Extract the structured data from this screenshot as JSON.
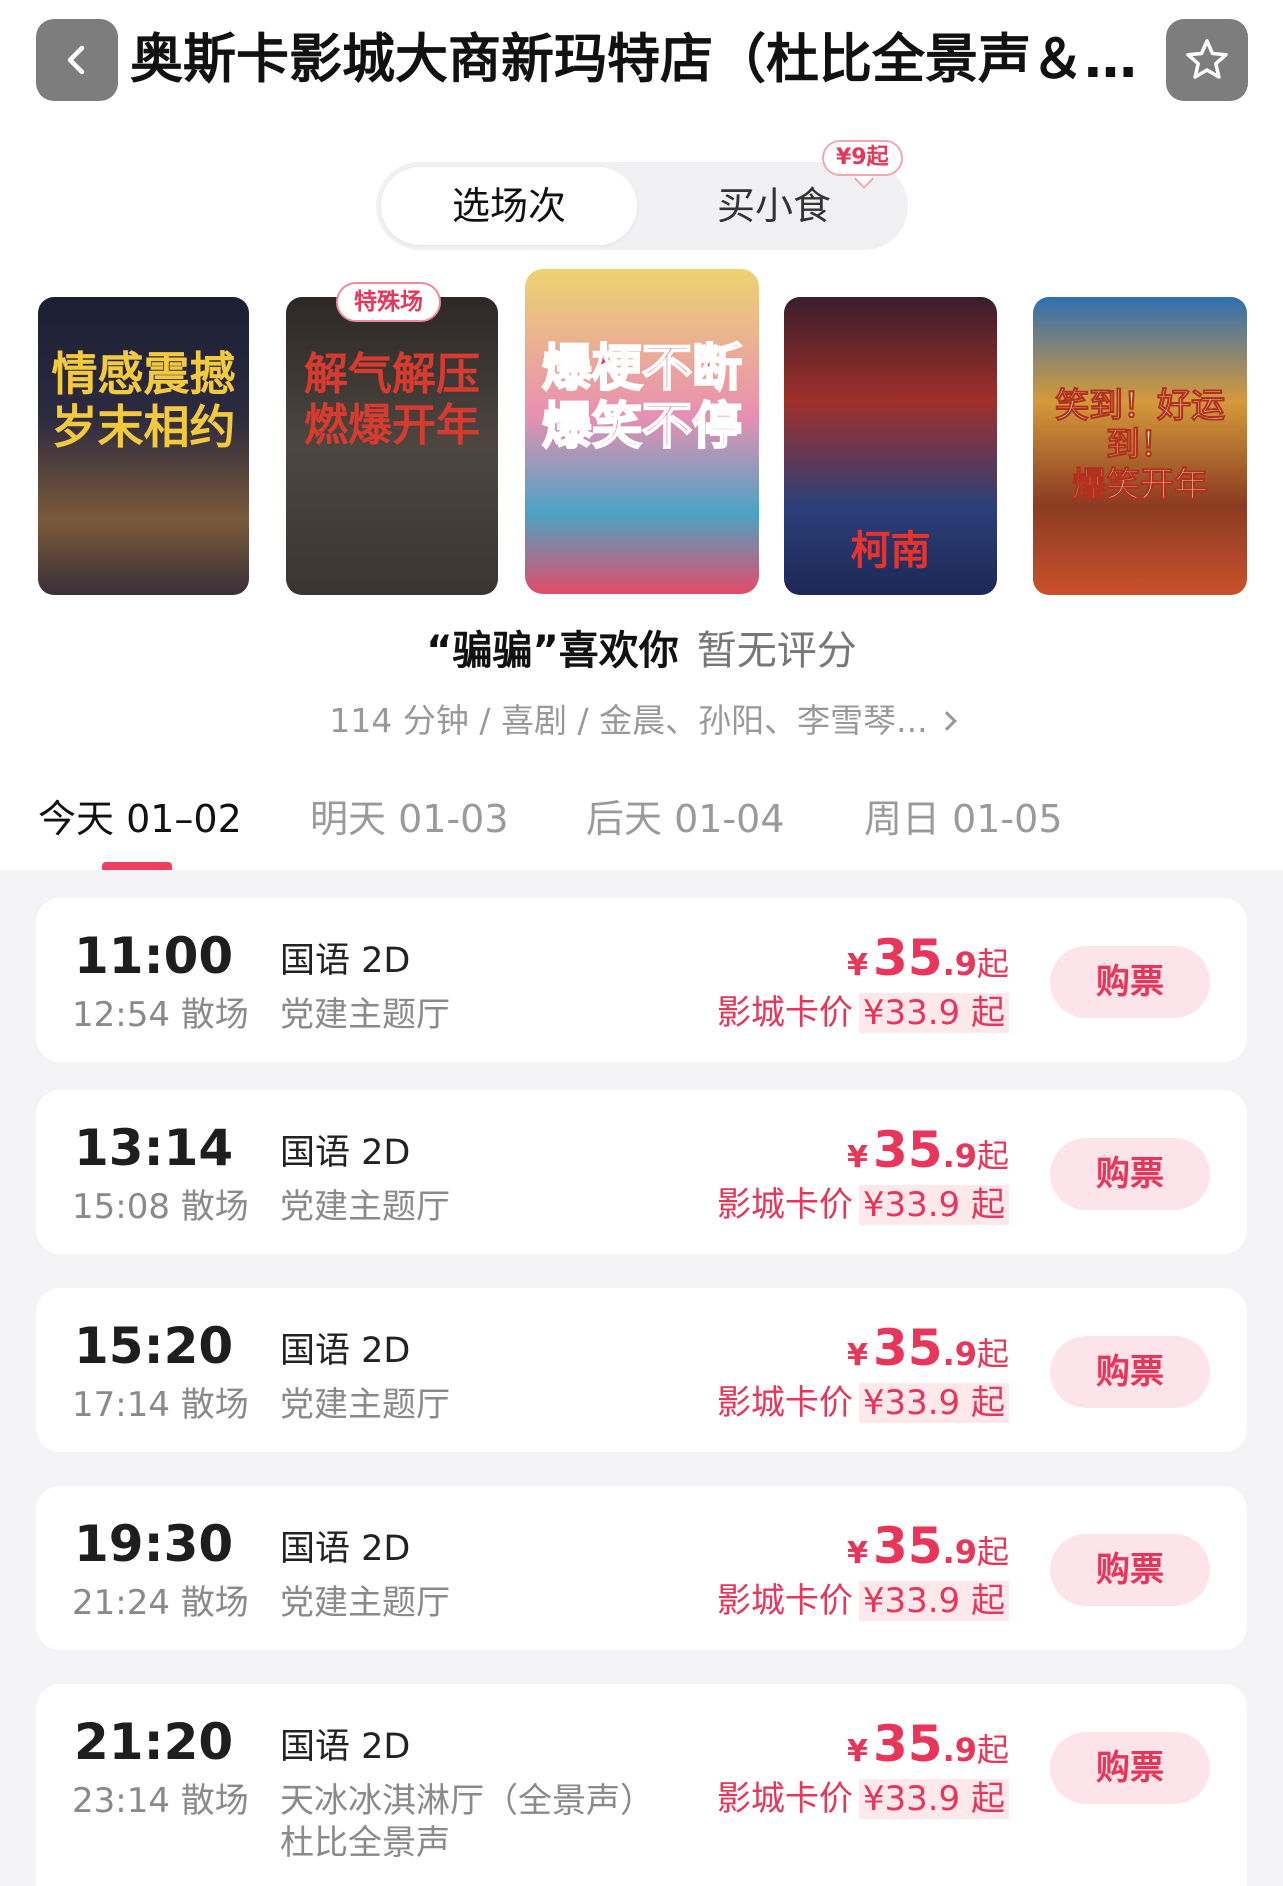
{
  "header": {
    "title": "奥斯卡影城大商新玛特店（杜比全景声＆…",
    "back_icon": "chevron-left-icon",
    "favorite_icon": "star-outline-icon"
  },
  "tabs": {
    "showtimes_label": "选场次",
    "snacks_label": "买小食",
    "snacks_badge": "¥9起"
  },
  "posters": [
    {
      "text": "情感震撼\n岁末相约"
    },
    {
      "text": "解气解压\n燃爆开年",
      "tag": "特殊场"
    },
    {
      "text": "爆梗不断\n爆笑不停"
    },
    {
      "text": "柯南"
    },
    {
      "text": "笑到！好运到！\n爆笑开年"
    }
  ],
  "movie": {
    "title": "“骗骗”喜欢你",
    "rating": "暂无评分",
    "meta": "114 分钟 / 喜剧 / 金晨、孙阳、李雪琴..."
  },
  "dates": [
    {
      "label": "今天 01–02",
      "active": true
    },
    {
      "label": "明天  01-03",
      "active": false
    },
    {
      "label": "后天  01-04",
      "active": false
    },
    {
      "label": "周日  01-05",
      "active": false
    }
  ],
  "showtimes": [
    {
      "start": "11:00",
      "end": "12:54 散场",
      "lang": "国语 2D",
      "hall": "党建主题厅",
      "hall2": "",
      "price_symbol": "¥",
      "price_int": "35",
      "price_dec": ".9",
      "price_suffix": "起",
      "card_label": "影城卡价",
      "card_price": "¥33.9 起",
      "buy_label": "购票"
    },
    {
      "start": "13:14",
      "end": "15:08 散场",
      "lang": "国语 2D",
      "hall": "党建主题厅",
      "hall2": "",
      "price_symbol": "¥",
      "price_int": "35",
      "price_dec": ".9",
      "price_suffix": "起",
      "card_label": "影城卡价",
      "card_price": "¥33.9 起",
      "buy_label": "购票"
    },
    {
      "start": "15:20",
      "end": "17:14 散场",
      "lang": "国语 2D",
      "hall": "党建主题厅",
      "hall2": "",
      "price_symbol": "¥",
      "price_int": "35",
      "price_dec": ".9",
      "price_suffix": "起",
      "card_label": "影城卡价",
      "card_price": "¥33.9 起",
      "buy_label": "购票"
    },
    {
      "start": "19:30",
      "end": "21:24 散场",
      "lang": "国语 2D",
      "hall": "党建主题厅",
      "hall2": "",
      "price_symbol": "¥",
      "price_int": "35",
      "price_dec": ".9",
      "price_suffix": "起",
      "card_label": "影城卡价",
      "card_price": "¥33.9 起",
      "buy_label": "购票"
    },
    {
      "start": "21:20",
      "end": "23:14 散场",
      "lang": "国语 2D",
      "hall": "天冰冰淇淋厅（全景声）",
      "hall2": "杜比全景声",
      "price_symbol": "¥",
      "price_int": "35",
      "price_dec": ".9",
      "price_suffix": "起",
      "card_label": "影城卡价",
      "card_price": "¥33.9 起",
      "buy_label": "购票"
    }
  ],
  "colors": {
    "accent": "#e8355a",
    "accent_light": "#fde4ea",
    "list_bg": "#f4f4f6"
  }
}
